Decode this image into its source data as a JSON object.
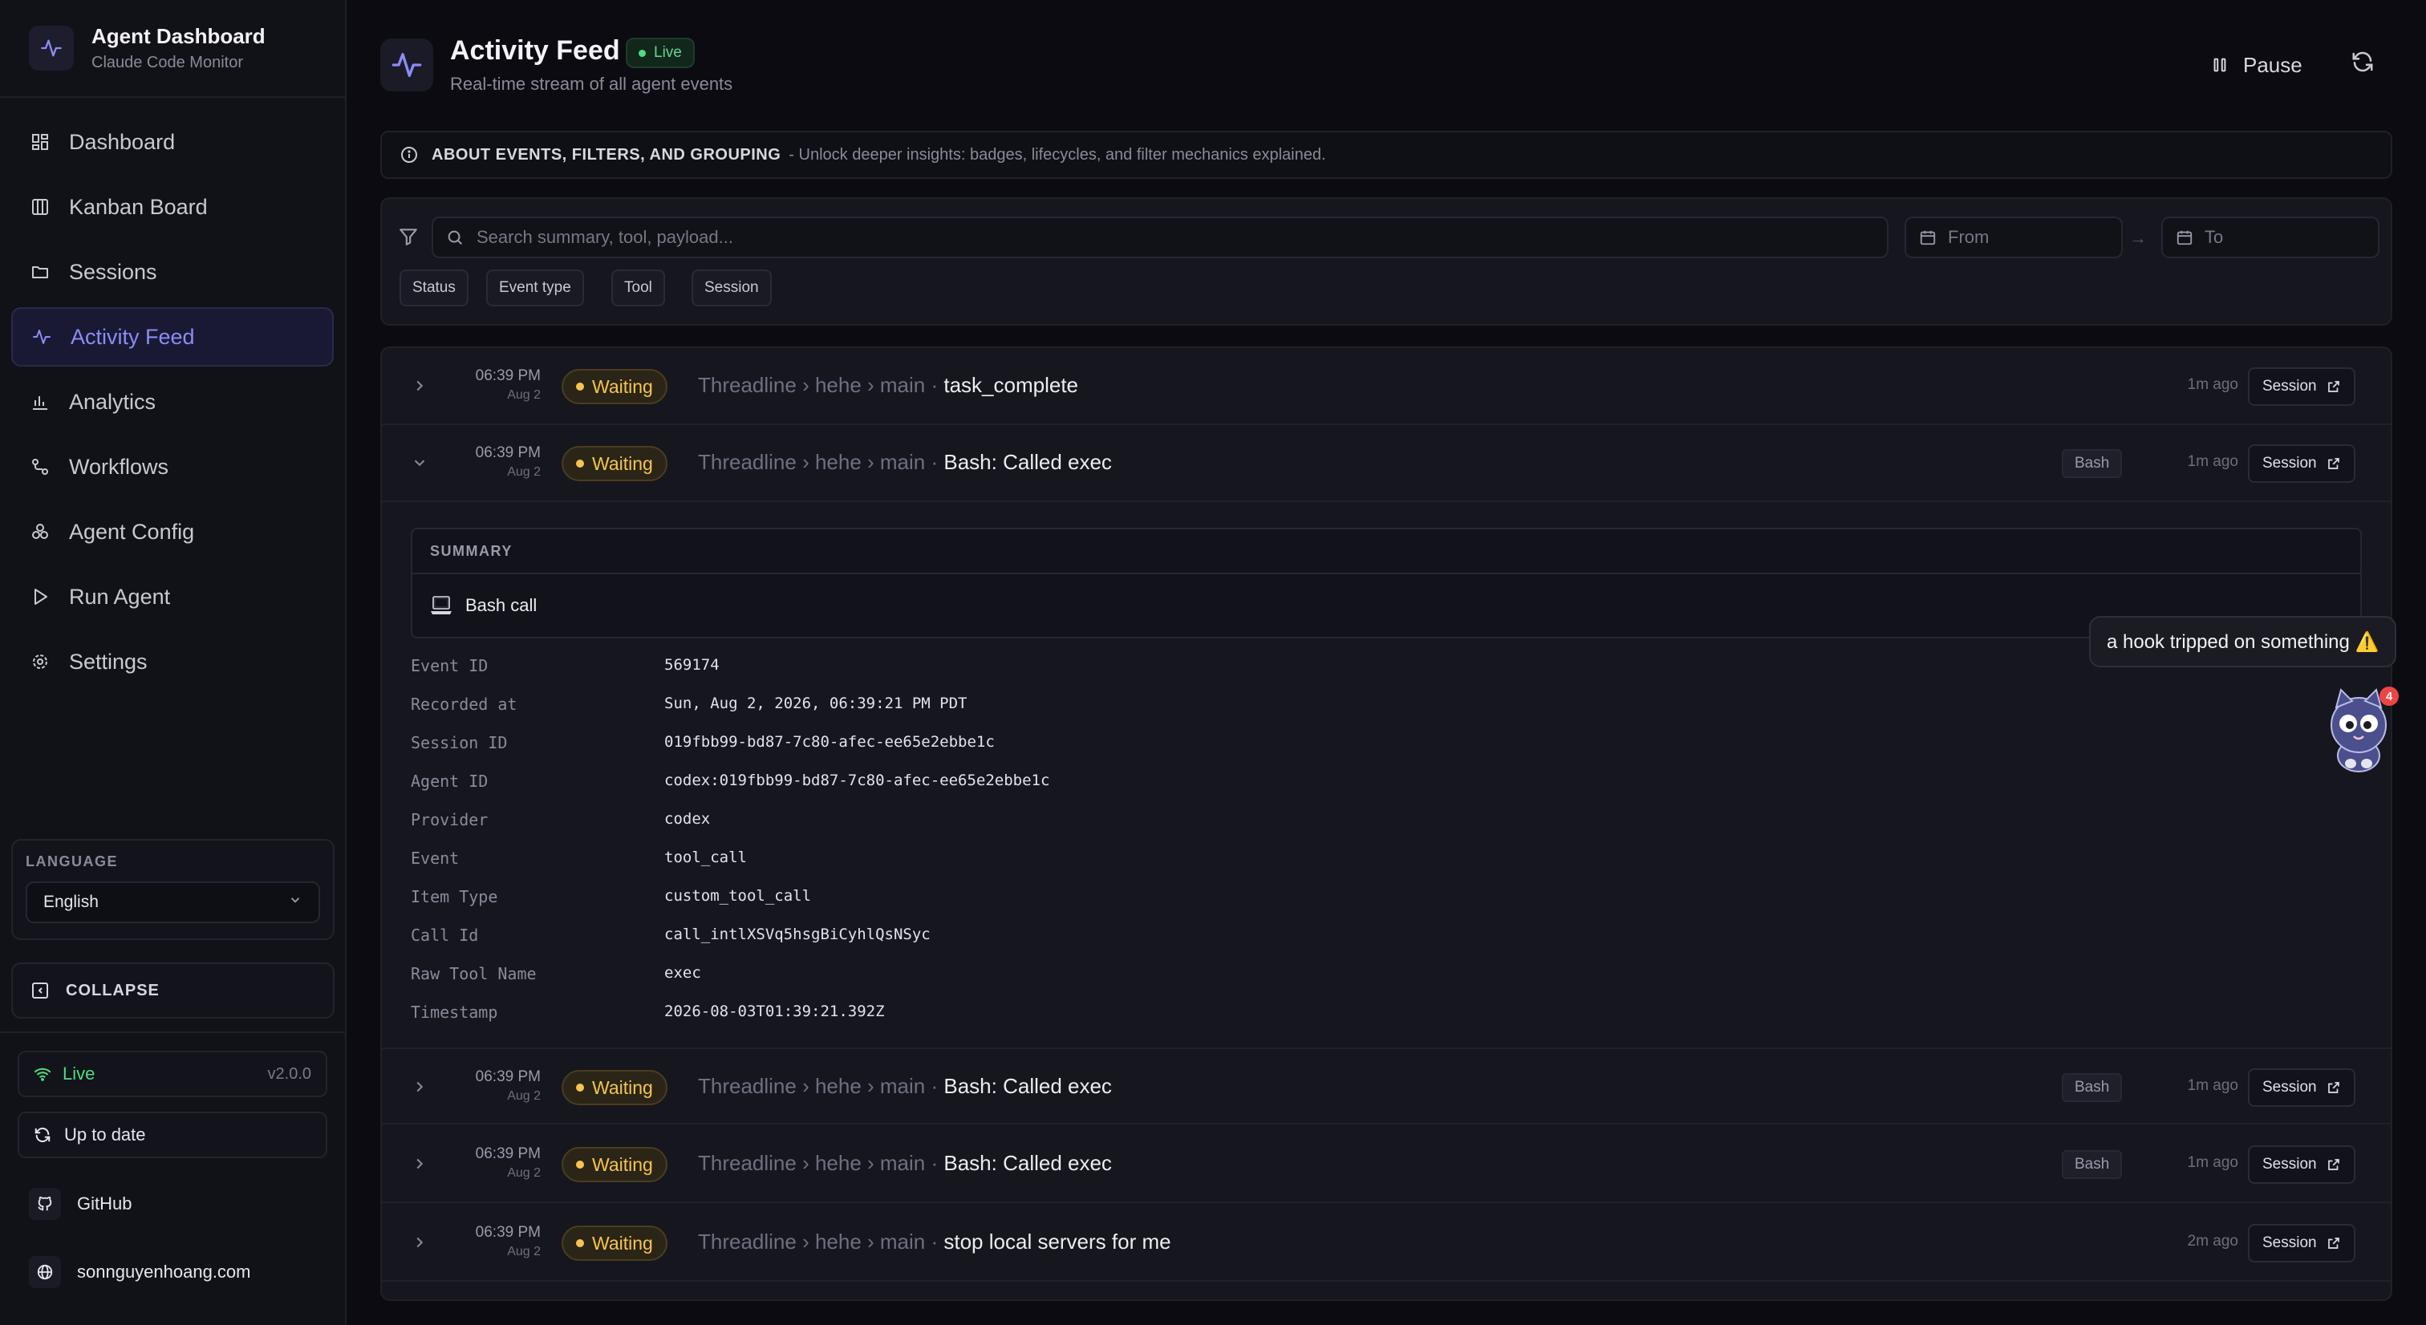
{
  "app": {
    "title": "Agent Dashboard",
    "subtitle": "Claude Code Monitor"
  },
  "sidebar": {
    "items": [
      {
        "label": "Dashboard",
        "icon": "dashboard-icon"
      },
      {
        "label": "Kanban Board",
        "icon": "kanban-icon"
      },
      {
        "label": "Sessions",
        "icon": "folder-icon"
      },
      {
        "label": "Activity Feed",
        "icon": "activity-icon",
        "active": true
      },
      {
        "label": "Analytics",
        "icon": "chart-icon"
      },
      {
        "label": "Workflows",
        "icon": "workflow-icon"
      },
      {
        "label": "Agent Config",
        "icon": "config-icon"
      },
      {
        "label": "Run Agent",
        "icon": "play-icon"
      },
      {
        "label": "Settings",
        "icon": "gear-icon"
      }
    ],
    "language_label": "LANGUAGE",
    "language_value": "English",
    "collapse_label": "COLLAPSE",
    "status_label": "Live",
    "version": "v2.0.0",
    "update_label": "Up to date",
    "github_label": "GitHub",
    "website_label": "sonnguyenhoang.com"
  },
  "header": {
    "title": "Activity Feed",
    "live_badge": "Live",
    "subtitle": "Real-time stream of all agent events",
    "pause_label": "Pause"
  },
  "about": {
    "title": "ABOUT EVENTS, FILTERS, AND GROUPING",
    "description": "- Unlock deeper insights: badges, lifecycles, and filter mechanics explained."
  },
  "filters": {
    "search_placeholder": "Search summary, tool, payload...",
    "from_placeholder": "From",
    "to_placeholder": "To",
    "chips": [
      "Status",
      "Event type",
      "Tool",
      "Session"
    ]
  },
  "events": [
    {
      "time": "06:39 PM",
      "date": "Aug 2",
      "status": "Waiting",
      "path": "Threadline › hehe › main · ",
      "message": "task_complete",
      "tool": "",
      "ago": "1m ago",
      "session_label": "Session",
      "expanded": false
    },
    {
      "time": "06:39 PM",
      "date": "Aug 2",
      "status": "Waiting",
      "path": "Threadline › hehe › main · ",
      "message": "Bash: Called exec",
      "tool": "Bash",
      "ago": "1m ago",
      "session_label": "Session",
      "expanded": true
    },
    {
      "time": "06:39 PM",
      "date": "Aug 2",
      "status": "Waiting",
      "path": "Threadline › hehe › main · ",
      "message": "Bash: Called exec",
      "tool": "Bash",
      "ago": "1m ago",
      "session_label": "Session",
      "expanded": false
    },
    {
      "time": "06:39 PM",
      "date": "Aug 2",
      "status": "Waiting",
      "path": "Threadline › hehe › main · ",
      "message": "Bash: Called exec",
      "tool": "Bash",
      "ago": "1m ago",
      "session_label": "Session",
      "expanded": false
    },
    {
      "time": "06:39 PM",
      "date": "Aug 2",
      "status": "Waiting",
      "path": "Threadline › hehe › main · ",
      "message": "stop local servers for me",
      "tool": "",
      "ago": "2m ago",
      "session_label": "Session",
      "expanded": false
    }
  ],
  "detail": {
    "summary_label": "SUMMARY",
    "summary_text": "Bash call",
    "fields": [
      {
        "label": "Event ID",
        "value": "569174"
      },
      {
        "label": "Recorded at",
        "value": "Sun, Aug 2, 2026, 06:39:21 PM PDT"
      },
      {
        "label": "Session ID",
        "value": "019fbb99-bd87-7c80-afec-ee65e2ebbe1c"
      },
      {
        "label": "Agent ID",
        "value": "codex:019fbb99-bd87-7c80-afec-ee65e2ebbe1c"
      },
      {
        "label": "Provider",
        "value": "codex"
      },
      {
        "label": "Event",
        "value": "tool_call"
      },
      {
        "label": "Item Type",
        "value": "custom_tool_call"
      },
      {
        "label": "Call Id",
        "value": "call_intlXSVq5hsgBiCyhlQsNSyc"
      },
      {
        "label": "Raw Tool Name",
        "value": "exec"
      },
      {
        "label": "Timestamp",
        "value": "2026-08-03T01:39:21.392Z"
      }
    ]
  },
  "toast": {
    "text": "a hook tripped on something ⚠️"
  },
  "mascot": {
    "badge_count": "4"
  },
  "colors": {
    "accent": "#8b8cf6",
    "live": "#4ade80",
    "waiting": "#f5c451",
    "background": "#0b0b11"
  }
}
